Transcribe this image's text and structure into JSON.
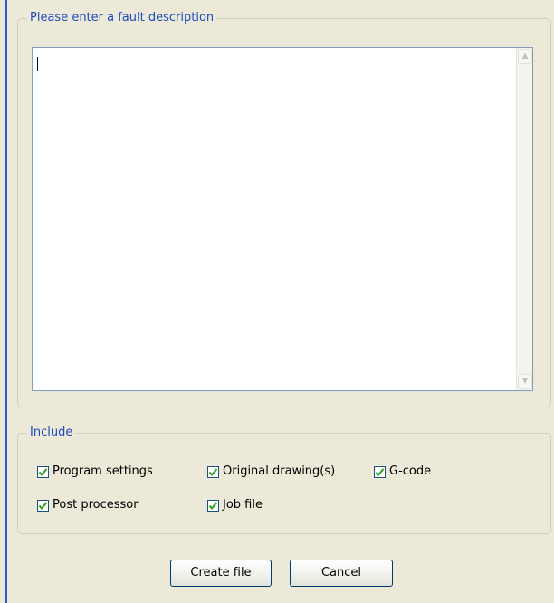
{
  "fault_description": {
    "legend": "Please enter a fault description",
    "text_value": ""
  },
  "include": {
    "legend": "Include",
    "checkboxes": [
      {
        "label": "Program settings",
        "checked": true
      },
      {
        "label": "Original drawing(s)",
        "checked": true
      },
      {
        "label": "G-code",
        "checked": true
      },
      {
        "label": "Post processor",
        "checked": true
      },
      {
        "label": "Job file",
        "checked": true
      }
    ]
  },
  "buttons": {
    "create_label": "Create file",
    "cancel_label": "Cancel"
  },
  "colors": {
    "dialog_bg": "#ece9d8",
    "legend_text": "#1d4bc0",
    "checkmark": "#21a121",
    "accent_border": "#2a5bc9"
  }
}
